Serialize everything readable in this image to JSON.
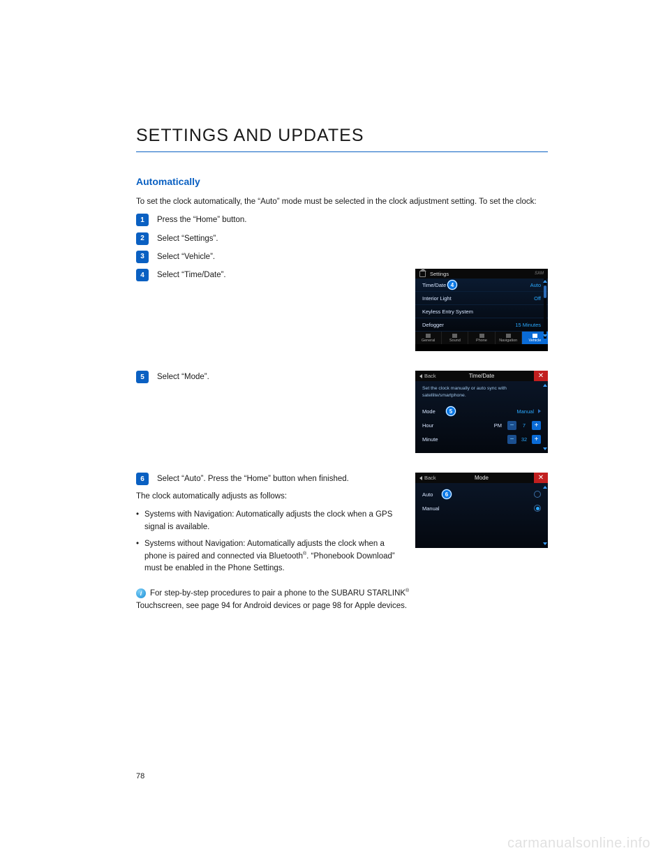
{
  "heading": "SETTINGS AND UPDATES",
  "subhead": "Automatically",
  "intro": "To set the clock automatically, the “Auto” mode must be selected in the clock adjustment setting. To set the clock:",
  "steps": {
    "s1": {
      "n": "1",
      "t": "Press the “Home” button."
    },
    "s2": {
      "n": "2",
      "t": "Select “Settings”."
    },
    "s3": {
      "n": "3",
      "t": "Select “Vehicle”."
    },
    "s4": {
      "n": "4",
      "t": "Select “Time/Date”."
    },
    "s5": {
      "n": "5",
      "t": "Select “Mode”."
    },
    "s6": {
      "n": "6",
      "t": "Select “Auto”. Press the “Home” button when finished."
    }
  },
  "after": {
    "p1": "The clock automatically adjusts as follows:",
    "b1": "Systems with Navigation: Automatically adjusts the clock when a GPS signal is available.",
    "b2_a": "Systems without Navigation: Automatically adjusts the clock when a phone is paired and connected via Bluetooth",
    "b2_b": ". “Phonebook Download” must be enabled in the Phone Settings.",
    "info_a": "For step-by-step procedures to pair a phone to the SUBARU STARLINK",
    "info_b": "Touchscreen, see page 94 for Android devices or page 98 for Apple devices."
  },
  "reg": "®",
  "page_number": "78",
  "watermark": "carmanualsonline.info",
  "mock1": {
    "title": "Settings",
    "sxm": "SXM",
    "rows": {
      "r1": {
        "lab": "Time/Date",
        "val": "Auto"
      },
      "r2": {
        "lab": "Interior Light",
        "val": "Off"
      },
      "r3": {
        "lab": "Keyless Entry System",
        "val": ""
      },
      "r4": {
        "lab": "Defogger",
        "val": "15 Minutes"
      }
    },
    "tabs": {
      "t1": "General",
      "t2": "Sound",
      "t3": "Phone",
      "t4": "Navigation",
      "t5": "Vehicle"
    },
    "callout": "4"
  },
  "mock2": {
    "back": "Back",
    "title": "Time/Date",
    "desc": "Set the clock manually or auto sync with satellite/smartphone.",
    "mode": {
      "lab": "Mode",
      "val": "Manual"
    },
    "hour": {
      "lab": "Hour",
      "pm": "PM",
      "val": "7"
    },
    "minute": {
      "lab": "Minute",
      "val": "32"
    },
    "callout": "5"
  },
  "mock3": {
    "back": "Back",
    "title": "Mode",
    "rows": {
      "r1": "Auto",
      "r2": "Manual"
    },
    "callout": "6"
  }
}
